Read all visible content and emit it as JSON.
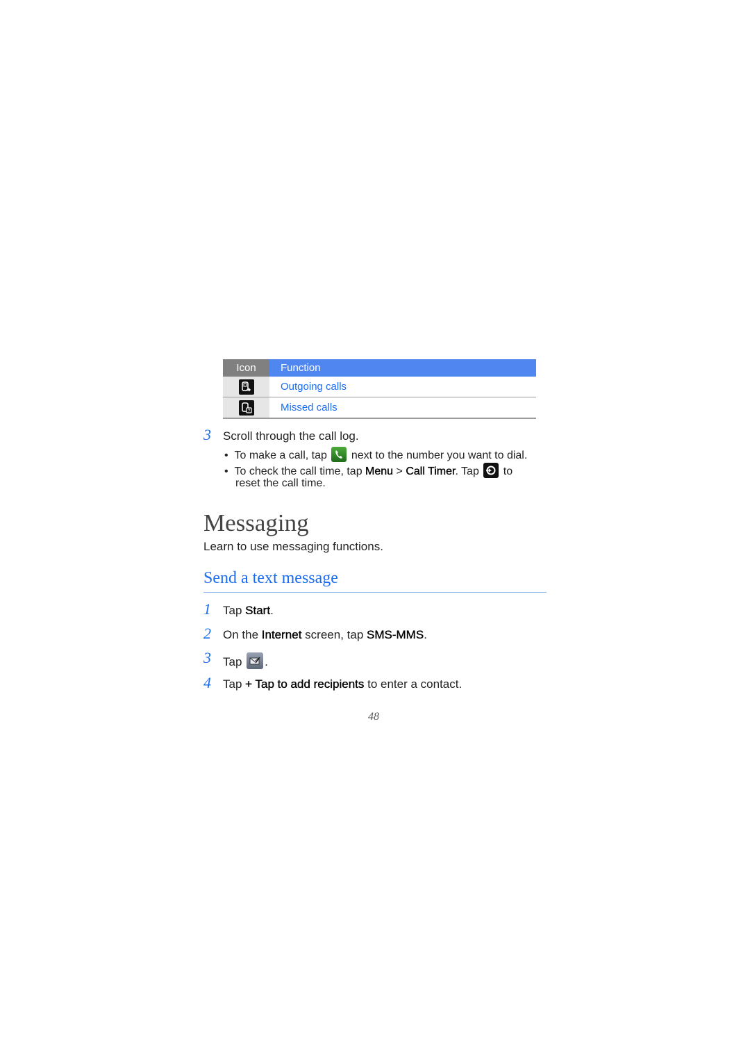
{
  "table": {
    "headers": {
      "icon": "Icon",
      "function": "Function"
    },
    "rows": [
      {
        "icon": "outgoing-calls-icon",
        "function": "Outgoing calls"
      },
      {
        "icon": "missed-calls-icon",
        "function": "Missed calls"
      }
    ]
  },
  "call_log_step": {
    "number": "3",
    "text": "Scroll through the call log.",
    "bullets": [
      {
        "before": "To make a call, tap",
        "icon": "phone-call-icon",
        "after": "next to the number you want to dial."
      },
      {
        "before": "To check the call time, tap",
        "menu": "Menu",
        "sep": ">",
        "item": "Call Timer",
        "mid": ". Tap",
        "icon": "reset-icon",
        "after": "to",
        "line2": "reset the call time."
      }
    ]
  },
  "section": {
    "title": "Messaging",
    "intro": "Learn to use messaging functions."
  },
  "subsection": {
    "title": "Send a text message",
    "steps": [
      {
        "number": "1",
        "pre": "Tap",
        "bold": "Start",
        "post": "."
      },
      {
        "number": "2",
        "pre": "On the",
        "bold1": "Internet",
        "mid": "screen, tap",
        "bold2": "SMS-MMS",
        "post": "."
      },
      {
        "number": "3",
        "pre": "Tap",
        "icon": "compose-message-icon",
        "post": "."
      },
      {
        "number": "4",
        "pre": "Tap",
        "bold": "+ Tap to add recipients",
        "post": "to enter a contact."
      }
    ]
  },
  "page_number": "48",
  "colors": {
    "accent_blue": "#1a6cf0",
    "header_blue": "#4f86f0",
    "header_gray": "#808080"
  }
}
